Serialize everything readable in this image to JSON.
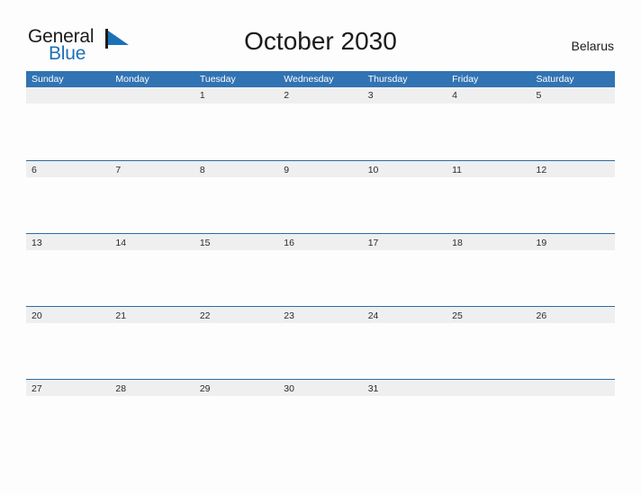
{
  "brand": {
    "name_part1": "General",
    "name_part2": "Blue",
    "flag_icon": "blue-flag-triangle-icon",
    "accent_color": "#1d70b8"
  },
  "header": {
    "title": "October 2030",
    "country": "Belarus"
  },
  "colors": {
    "header_row_background": "#3273b3",
    "week_band_background": "#efefef",
    "week_band_border_top": "#2c6da4",
    "page_background": "#fdfdfd",
    "text": "#2b2b2b"
  },
  "calendar": {
    "month": "October",
    "year": "2030",
    "day_headers": [
      "Sunday",
      "Monday",
      "Tuesday",
      "Wednesday",
      "Thursday",
      "Friday",
      "Saturday"
    ],
    "weeks": [
      {
        "has_top_border": false,
        "days": [
          "",
          "",
          "1",
          "2",
          "3",
          "4",
          "5"
        ]
      },
      {
        "has_top_border": true,
        "days": [
          "6",
          "7",
          "8",
          "9",
          "10",
          "11",
          "12"
        ]
      },
      {
        "has_top_border": true,
        "days": [
          "13",
          "14",
          "15",
          "16",
          "17",
          "18",
          "19"
        ]
      },
      {
        "has_top_border": true,
        "days": [
          "20",
          "21",
          "22",
          "23",
          "24",
          "25",
          "26"
        ]
      },
      {
        "has_top_border": true,
        "days": [
          "27",
          "28",
          "29",
          "30",
          "31",
          "",
          ""
        ]
      }
    ]
  }
}
